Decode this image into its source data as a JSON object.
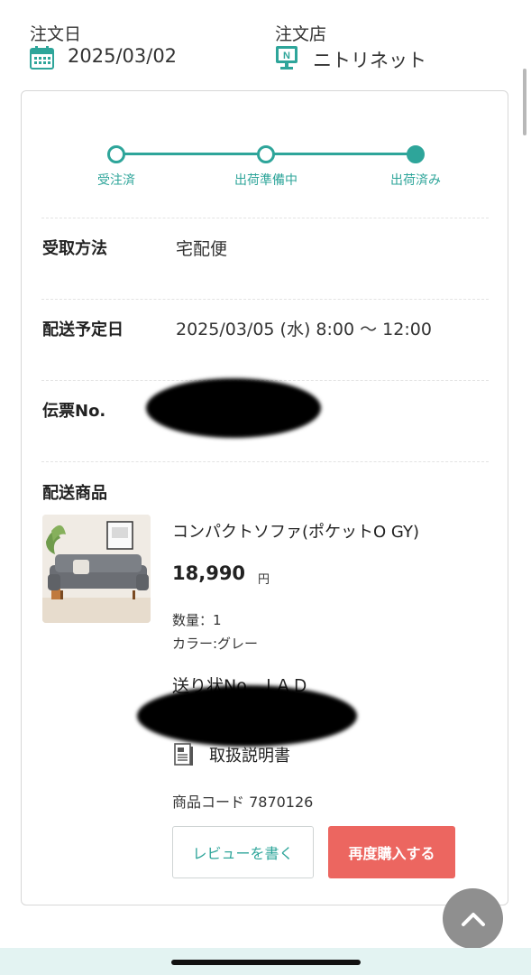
{
  "header": {
    "order_date_label": "注文日",
    "order_date": "2025/03/02",
    "store_label": "注文店",
    "store_name": "ニトリネット",
    "icons": [
      "calendar-icon",
      "store-icon"
    ]
  },
  "status": {
    "steps": [
      {
        "label": "受注済",
        "state": "done"
      },
      {
        "label": "出荷準備中",
        "state": "done"
      },
      {
        "label": "出荷済み",
        "state": "current"
      }
    ],
    "color": "#2ea59a"
  },
  "details": {
    "receive_method_label": "受取方法",
    "receive_method": "宅配便",
    "delivery_date_label": "配送予定日",
    "delivery_date": "2025/03/05 (水) 8:00 〜 12:00",
    "slip_label": "伝票No."
  },
  "product": {
    "section_label": "配送商品",
    "name": "コンパクトソファ(ポケットO GY)",
    "price": "18,990",
    "currency": "円",
    "quantity": "数量：1",
    "color": "カラー:グレー",
    "invoice_prefix": "送り状No. ＪＡＤ",
    "manual_label": "取扱説明書",
    "code": "商品コード 7870126"
  },
  "actions": {
    "review_label": "レビューを書く",
    "rebuy_label": "再度購入する",
    "accent": "#ec6660"
  }
}
